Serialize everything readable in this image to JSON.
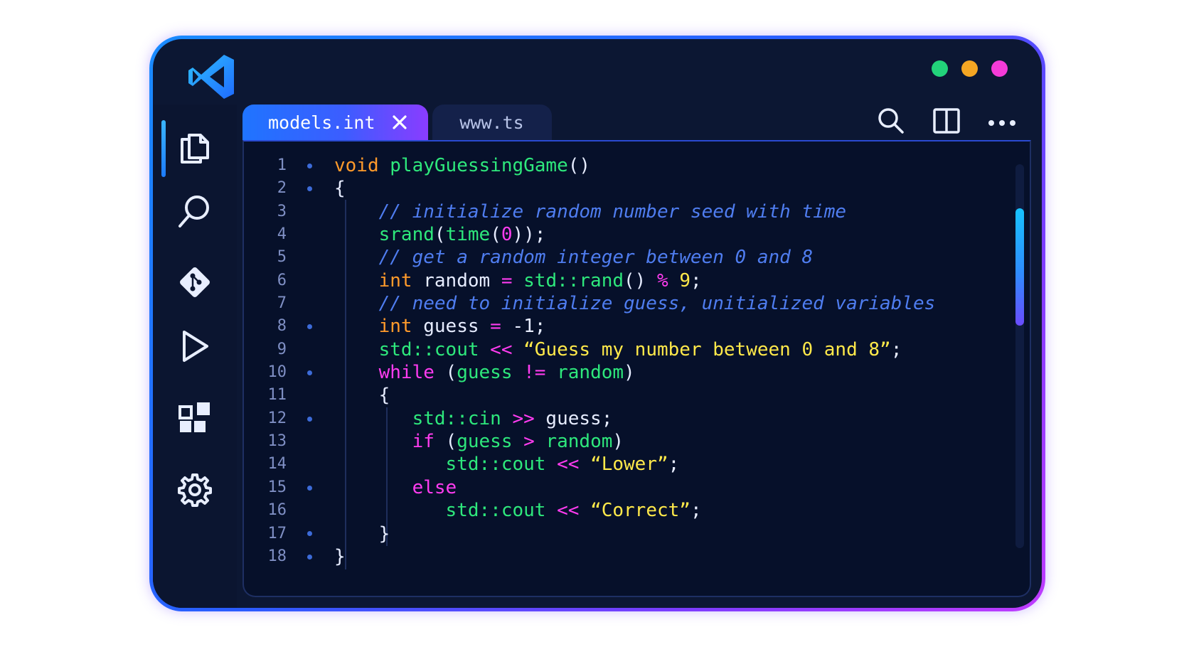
{
  "window": {
    "traffic_lights": [
      {
        "name": "green",
        "color": "#22d37a"
      },
      {
        "name": "yellow",
        "color": "#f5a623"
      },
      {
        "name": "magenta",
        "color": "#f53bd8"
      }
    ]
  },
  "activity_bar": {
    "items": [
      {
        "icon": "files-icon",
        "active": true
      },
      {
        "icon": "search-icon",
        "active": false
      },
      {
        "icon": "git-icon",
        "active": false
      },
      {
        "icon": "run-icon",
        "active": false
      },
      {
        "icon": "extensions-icon",
        "active": false
      },
      {
        "icon": "settings-icon",
        "active": false
      }
    ]
  },
  "tabs": [
    {
      "label": "models.int",
      "active": true
    },
    {
      "label": "www.ts",
      "active": false
    }
  ],
  "toolbar": {
    "icons": [
      "search-icon",
      "split-editor-icon",
      "more-icon"
    ]
  },
  "editor": {
    "line_numbers": [
      "1",
      "2",
      "3",
      "4",
      "5",
      "6",
      "7",
      "8",
      "9",
      "10",
      "11",
      "12",
      "13",
      "14",
      "15",
      "16",
      "17",
      "18"
    ],
    "code": [
      [
        {
          "t": "void",
          "c": "kw"
        },
        {
          "t": " "
        },
        {
          "t": "playGuessingGame",
          "c": "fn"
        },
        {
          "t": "()",
          "c": "wh"
        }
      ],
      [
        {
          "t": "{"
        }
      ],
      [
        {
          "t": "    "
        },
        {
          "t": "// initialize random number seed with time",
          "c": "cm"
        }
      ],
      [
        {
          "t": "    "
        },
        {
          "t": "srand",
          "c": "fn"
        },
        {
          "t": "("
        },
        {
          "t": "time",
          "c": "fn"
        },
        {
          "t": "("
        },
        {
          "t": "0",
          "c": "pk"
        },
        {
          "t": "));"
        }
      ],
      [
        {
          "t": "    "
        },
        {
          "t": "// get a random integer between 0 and 8",
          "c": "cm"
        }
      ],
      [
        {
          "t": "    "
        },
        {
          "t": "int",
          "c": "kw"
        },
        {
          "t": " random "
        },
        {
          "t": "=",
          "c": "pk"
        },
        {
          "t": " "
        },
        {
          "t": "std::rand",
          "c": "fn"
        },
        {
          "t": "() "
        },
        {
          "t": "%",
          "c": "pk"
        },
        {
          "t": " "
        },
        {
          "t": "9",
          "c": "nm"
        },
        {
          "t": ";"
        }
      ],
      [
        {
          "t": "    "
        },
        {
          "t": "// need to initialize guess, unitialized variables",
          "c": "cm"
        }
      ],
      [
        {
          "t": "    "
        },
        {
          "t": "int",
          "c": "kw"
        },
        {
          "t": " guess "
        },
        {
          "t": "=",
          "c": "pk"
        },
        {
          "t": " -1;"
        }
      ],
      [
        {
          "t": "    "
        },
        {
          "t": "std::cout",
          "c": "fn"
        },
        {
          "t": " "
        },
        {
          "t": "<<",
          "c": "pk"
        },
        {
          "t": " "
        },
        {
          "t": "“Guess my number between 0 and 8”",
          "c": "st"
        },
        {
          "t": ";"
        }
      ],
      [
        {
          "t": "    "
        },
        {
          "t": "while",
          "c": "pk"
        },
        {
          "t": " ("
        },
        {
          "t": "guess",
          "c": "fn"
        },
        {
          "t": " "
        },
        {
          "t": "!=",
          "c": "pk"
        },
        {
          "t": " "
        },
        {
          "t": "random",
          "c": "fn"
        },
        {
          "t": ")"
        }
      ],
      [
        {
          "t": "    {"
        }
      ],
      [
        {
          "t": "       "
        },
        {
          "t": "std::cin",
          "c": "fn"
        },
        {
          "t": " "
        },
        {
          "t": ">>",
          "c": "pk"
        },
        {
          "t": " guess;"
        }
      ],
      [
        {
          "t": "       "
        },
        {
          "t": "if",
          "c": "pk"
        },
        {
          "t": " ("
        },
        {
          "t": "guess",
          "c": "fn"
        },
        {
          "t": " "
        },
        {
          "t": ">",
          "c": "pk"
        },
        {
          "t": " "
        },
        {
          "t": "random",
          "c": "fn"
        },
        {
          "t": ")"
        }
      ],
      [
        {
          "t": "          "
        },
        {
          "t": "std::cout",
          "c": "fn"
        },
        {
          "t": " "
        },
        {
          "t": "<<",
          "c": "pk"
        },
        {
          "t": " "
        },
        {
          "t": "“Lower”",
          "c": "st"
        },
        {
          "t": ";"
        }
      ],
      [
        {
          "t": "       "
        },
        {
          "t": "else",
          "c": "pk"
        }
      ],
      [
        {
          "t": "          "
        },
        {
          "t": "std::cout",
          "c": "fn"
        },
        {
          "t": " "
        },
        {
          "t": "<<",
          "c": "pk"
        },
        {
          "t": " "
        },
        {
          "t": "“Correct”",
          "c": "st"
        },
        {
          "t": ";"
        }
      ],
      [
        {
          "t": "    }"
        }
      ],
      [
        {
          "t": "}"
        }
      ]
    ],
    "fold_markers": [
      1,
      2,
      8,
      10,
      12,
      15,
      17,
      18
    ]
  }
}
